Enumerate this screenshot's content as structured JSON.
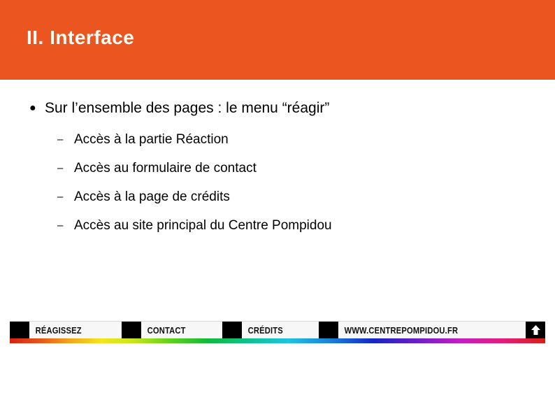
{
  "slide": {
    "title": "II. Interface",
    "header_color": "#ea5520",
    "background_color": "#ffffff"
  },
  "content": {
    "main_bullet": {
      "marker": "bullet-dot",
      "text": "Sur l’ensemble des pages : le menu “réagir”"
    },
    "sub_bullets": [
      {
        "marker": "en-dash",
        "text": "Accès à la partie Réaction"
      },
      {
        "marker": "en-dash",
        "text": "Accès au formulaire de contact"
      },
      {
        "marker": "en-dash",
        "text": "Accès à la page de crédits"
      },
      {
        "marker": "en-dash",
        "text": "Accès au site principal du Centre Pompidou"
      }
    ]
  },
  "bottom_nav": {
    "items": [
      {
        "label": "RÉAGISSEZ"
      },
      {
        "label": "CONTACT"
      },
      {
        "label": "CRÉDITS"
      },
      {
        "label": "WWW.CENTREPOMPIDOU.FR"
      }
    ],
    "top_button_icon": "arrow-up-icon",
    "gradient_colors": [
      "#d81f13",
      "#f0a41b",
      "#f4e51e",
      "#11b93b",
      "#21c3e0",
      "#1624c9",
      "#c41ec4",
      "#d81f13"
    ]
  }
}
